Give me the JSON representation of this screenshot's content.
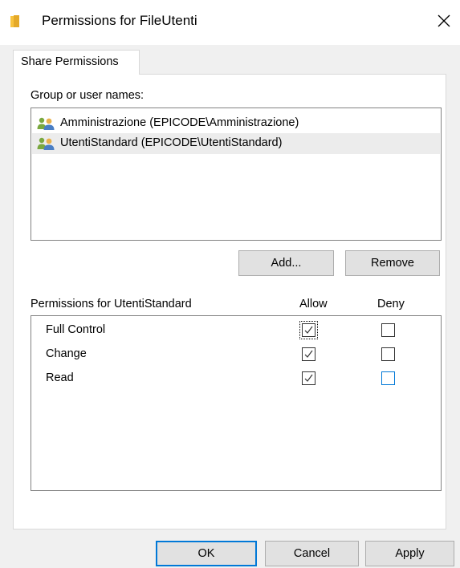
{
  "window": {
    "title": "Permissions for FileUtenti"
  },
  "tabs": [
    {
      "label": "Share Permissions",
      "selected": true
    }
  ],
  "group_section": {
    "label": "Group or user names:",
    "users": [
      {
        "name": "Amministrazione (EPICODE\\Amministrazione)",
        "icon": "group-users-icon",
        "selected": false
      },
      {
        "name": "UtentiStandard (EPICODE\\UtentiStandard)",
        "icon": "group-users-icon",
        "selected": true
      }
    ],
    "add_label": "Add...",
    "remove_label": "Remove"
  },
  "permissions": {
    "header": "Permissions for UtentiStandard",
    "allow_label": "Allow",
    "deny_label": "Deny",
    "rows": [
      {
        "name": "Full Control",
        "allow": true,
        "deny": false
      },
      {
        "name": "Change",
        "allow": true,
        "deny": false
      },
      {
        "name": "Read",
        "allow": true,
        "deny": false
      }
    ]
  },
  "footer": {
    "ok_label": "OK",
    "cancel_label": "Cancel",
    "apply_label": "Apply"
  },
  "colors": {
    "accent": "#0078d7",
    "dialog_bg": "#f0f0f0",
    "folder_yellow": "#f8c33e",
    "user_icon_green": "#7aa83f",
    "user_icon_blue": "#4a7ec4"
  }
}
